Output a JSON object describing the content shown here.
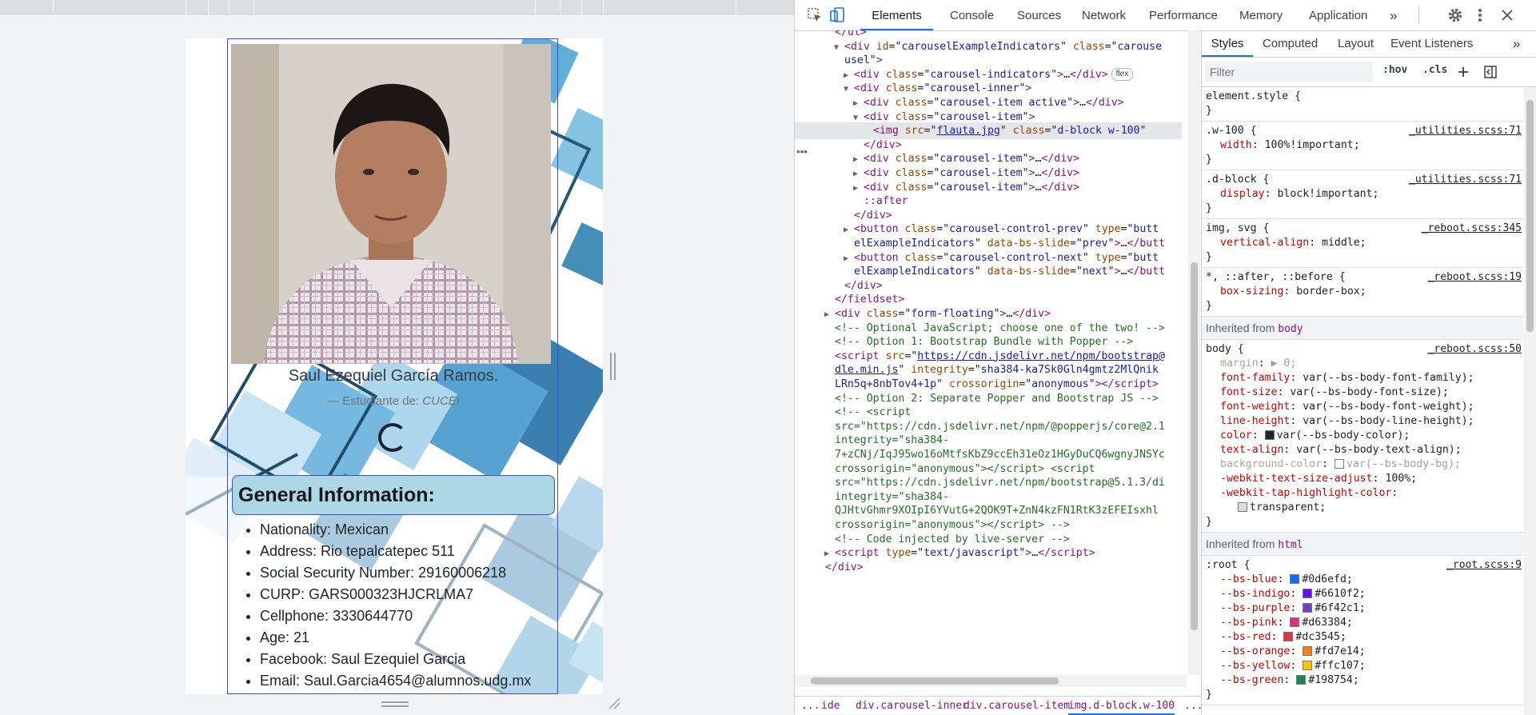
{
  "page": {
    "person_name": "Saul Ezequiel García Ramos.",
    "role_prefix": "— Estudiante de:",
    "role_org": "CUCEI",
    "info_title": "General Information:",
    "info_items": [
      "Nationality: Mexican",
      "Address: Rio tepalcatepec 511",
      "Social Security Number: 29160006218",
      "CURP: GARS000323HJCRLMA7",
      "Cellphone: 3330644770",
      "Age: 21",
      "Facebook: Saul Ezequiel Garcia",
      "Email: Saul.Garcia4654@alumnos.udg.mx"
    ]
  },
  "devtools": {
    "tabs": [
      "Elements",
      "Console",
      "Sources",
      "Network",
      "Performance",
      "Memory",
      "Application"
    ],
    "more_tabs": "»",
    "dom_lines": [
      {
        "indent": 0,
        "html": "<span class='tag'>&lt;/ul&gt;</span>"
      },
      {
        "indent": 1,
        "arrow": "▼",
        "html": "<span class='tag'>&lt;div</span> <span class='an'>id</span>=\"<span class='av'>carouselExampleIndicators</span>\" <span class='an'>class</span>=\"<span class='av'>carouse</span>"
      },
      {
        "indent": 1,
        "html": "<span class='av'>usel</span>\"<span class='tag'>&gt;</span>"
      },
      {
        "indent": 2,
        "arrow": "▶",
        "html": "<span class='tag'>&lt;div</span> <span class='an'>class</span>=\"<span class='av'>carousel-indicators</span>\"<span class='tag'>&gt;</span>…<span class='tag'>&lt;/div&gt;</span><span class='badge'>flex</span>"
      },
      {
        "indent": 2,
        "arrow": "▼",
        "html": "<span class='tag'>&lt;div</span> <span class='an'>class</span>=\"<span class='av'>carousel-inner</span>\"<span class='tag'>&gt;</span>"
      },
      {
        "indent": 3,
        "arrow": "▶",
        "html": "<span class='tag'>&lt;div</span> <span class='an'>class</span>=\"<span class='av'>carousel-item active</span>\"<span class='tag'>&gt;</span>…<span class='tag'>&lt;/div&gt;</span>"
      },
      {
        "indent": 3,
        "arrow": "▼",
        "html": "<span class='tag'>&lt;div</span> <span class='an'>class</span>=\"<span class='av'>carousel-item</span>\"<span class='tag'>&gt;</span>"
      },
      {
        "indent": 4,
        "sel": true,
        "html": "<span class='tag'>&lt;img</span> <span class='an'>src</span>=\"<span class='link'>flauta.jpg</span>\" <span class='an'>class</span>=\"<span class='av'>d-block w-100</span>\""
      },
      {
        "indent": 3,
        "html": "<span class='tag'>&lt;/div&gt;</span>"
      },
      {
        "indent": 3,
        "arrow": "▶",
        "html": "<span class='tag'>&lt;div</span> <span class='an'>class</span>=\"<span class='av'>carousel-item</span>\"<span class='tag'>&gt;</span>…<span class='tag'>&lt;/div&gt;</span>"
      },
      {
        "indent": 3,
        "arrow": "▶",
        "html": "<span class='tag'>&lt;div</span> <span class='an'>class</span>=\"<span class='av'>carousel-item</span>\"<span class='tag'>&gt;</span>…<span class='tag'>&lt;/div&gt;</span>"
      },
      {
        "indent": 3,
        "arrow": "▶",
        "html": "<span class='tag'>&lt;div</span> <span class='an'>class</span>=\"<span class='av'>carousel-item</span>\"<span class='tag'>&gt;</span>…<span class='tag'>&lt;/div&gt;</span>"
      },
      {
        "indent": 3,
        "html": "<span class='tag'>::after</span>"
      },
      {
        "indent": 2,
        "html": "<span class='tag'>&lt;/div&gt;</span>"
      },
      {
        "indent": 2,
        "arrow": "▶",
        "html": "<span class='tag'>&lt;button</span> <span class='an'>class</span>=\"<span class='av'>carousel-control-prev</span>\" <span class='an'>type</span>=\"<span class='av'>butt</span>"
      },
      {
        "indent": 2,
        "html": "<span class='av'>elExampleIndicators</span>\" <span class='an'>data-bs-slide</span>=\"<span class='av'>prev</span>\"<span class='tag'>&gt;</span>…<span class='tag'>&lt;/butt</span>"
      },
      {
        "indent": 2,
        "arrow": "▶",
        "html": "<span class='tag'>&lt;button</span> <span class='an'>class</span>=\"<span class='av'>carousel-control-next</span>\" <span class='an'>type</span>=\"<span class='av'>butt</span>"
      },
      {
        "indent": 2,
        "html": "<span class='av'>elExampleIndicators</span>\" <span class='an'>data-bs-slide</span>=\"<span class='av'>next</span>\"<span class='tag'>&gt;</span>…<span class='tag'>&lt;/butt</span>"
      },
      {
        "indent": 1,
        "html": "<span class='tag'>&lt;/div&gt;</span>"
      },
      {
        "indent": 0,
        "html": "<span class='tag'>&lt;/fieldset&gt;</span>"
      },
      {
        "indent": 0,
        "arrow": "▶",
        "html": "<span class='tag'>&lt;div</span> <span class='an'>class</span>=\"<span class='av'>form-floating</span>\"<span class='tag'>&gt;</span>…<span class='tag'>&lt;/div&gt;</span>"
      },
      {
        "indent": 0,
        "html": "<span class='cm'>&lt;!-- Optional JavaScript; choose one of the two! --&gt;</span>"
      },
      {
        "indent": 0,
        "html": "<span class='cm'>&lt;!-- Option 1: Bootstrap Bundle with Popper --&gt;</span>"
      },
      {
        "indent": 0,
        "html": "<span class='tag'>&lt;script</span> <span class='an'>src</span>=\"<span class='link'>https://cdn.jsdelivr.net/npm/bootstrap@</span>"
      },
      {
        "indent": 0,
        "html": "<span class='link'>dle.min.js</span>\" <span class='an'>integrity</span>=\"<span class='av'>sha384-ka7Sk0Gln4gmtz2MlQnik</span>"
      },
      {
        "indent": 0,
        "html": "<span class='av'>LRn5q+8nbTov4+1p</span>\" <span class='an'>crossorigin</span>=\"<span class='av'>anonymous</span>\"<span class='tag'>&gt;&lt;/script&gt;</span>"
      },
      {
        "indent": 0,
        "html": "<span class='cm'>&lt;!-- Option 2: Separate Popper and Bootstrap JS --&gt;</span>"
      },
      {
        "indent": 0,
        "html": "<span class='cm'>&lt;!--  &lt;script</span>"
      },
      {
        "indent": 0,
        "html": "<span class='cm'>src=\"https://cdn.jsdelivr.net/npm/@popperjs/core@2.1</span>"
      },
      {
        "indent": 0,
        "html": "<span class='cm'>integrity=\"sha384-</span>"
      },
      {
        "indent": 0,
        "html": "<span class='cm'>7+zCNj/IqJ95wo16oMtfsKbZ9ccEh31eOz1HGyDuCQ6wgnyJNSYc</span>"
      },
      {
        "indent": 0,
        "html": "<span class='cm'>crossorigin=\"anonymous\"&gt;&lt;/script&gt;  &lt;script</span>"
      },
      {
        "indent": 0,
        "html": "<span class='cm'>src=\"https://cdn.jsdelivr.net/npm/bootstrap@5.1.3/di</span>"
      },
      {
        "indent": 0,
        "html": "<span class='cm'>integrity=\"sha384-</span>"
      },
      {
        "indent": 0,
        "html": "<span class='cm'>QJHtvGhmr9XOIpI6YVutG+2QOK9T+ZnN4kzFN1RtK3zEFEIsxhl</span>"
      },
      {
        "indent": 0,
        "html": "<span class='cm'>crossorigin=\"anonymous\"&gt;&lt;/script&gt;  --&gt;</span>"
      },
      {
        "indent": 0,
        "html": "<span class='cm'>&lt;!-- Code injected by live-server --&gt;</span>"
      },
      {
        "indent": 0,
        "arrow": "▶",
        "html": "<span class='tag'>&lt;script</span> <span class='an'>type</span>=\"<span class='av'>text/javascript</span>\"<span class='tag'>&gt;</span>…<span class='tag'>&lt;/script&gt;</span>"
      },
      {
        "indent": -1,
        "html": "<span class='tag'>&lt;/div&gt;</span>"
      }
    ],
    "breadcrumb": [
      "...",
      "ide",
      "div.carousel-inner",
      "div.carousel-item",
      "img.d-block.w-100",
      "..."
    ],
    "styles_tabs": [
      "Styles",
      "Computed",
      "Layout",
      "Event Listeners"
    ],
    "filter_placeholder": "Filter",
    "filter_hov": ":hov",
    "filter_cls": ".cls",
    "rules": [
      {
        "selector": "element.style {",
        "source": "",
        "props": []
      },
      {
        "selector": ".w-100 {",
        "source": "_utilities.scss:71",
        "props": [
          [
            "width",
            "100%!important;"
          ]
        ]
      },
      {
        "selector": ".d-block {",
        "source": "_utilities.scss:71",
        "props": [
          [
            "display",
            "block!important;"
          ]
        ]
      },
      {
        "selector": "img, svg {",
        "source": "_reboot.scss:345",
        "props": [
          [
            "vertical-align",
            "middle;"
          ]
        ]
      },
      {
        "selector": "*, ::after, ::before {",
        "source": "_reboot.scss:19",
        "props": [
          [
            "box-sizing",
            "border-box;"
          ]
        ]
      }
    ],
    "inherited_body_label": "Inherited from",
    "inherited_body_tag": "body",
    "body_rule": {
      "selector": "body {",
      "source": "_reboot.scss:50",
      "props": [
        [
          "margin",
          "▶ 0;",
          true
        ],
        [
          "font-family",
          "var(--bs-body-font-family);"
        ],
        [
          "font-size",
          "var(--bs-body-font-size);"
        ],
        [
          "font-weight",
          "var(--bs-body-font-weight);"
        ],
        [
          "line-height",
          "var(--bs-body-line-height);"
        ],
        [
          "color",
          "var(--bs-body-color);"
        ],
        [
          "text-align",
          "var(--bs-body-text-align);"
        ],
        [
          "background-color",
          "var(--bs-body-bg);",
          true
        ],
        [
          "-webkit-text-size-adjust",
          "100%;"
        ],
        [
          "-webkit-tap-highlight-color",
          ""
        ],
        [
          "",
          "transparent;"
        ]
      ]
    },
    "inherited_html_tag": "html",
    "root_rule": {
      "selector": ":root {",
      "source": "_root.scss:9",
      "props": [
        [
          "--bs-blue",
          "#0d6efd;",
          "#0d6efd"
        ],
        [
          "--bs-indigo",
          "#6610f2;",
          "#6610f2"
        ],
        [
          "--bs-purple",
          "#6f42c1;",
          "#6f42c1"
        ],
        [
          "--bs-pink",
          "#d63384;",
          "#d63384"
        ],
        [
          "--bs-red",
          "#dc3545;",
          "#dc3545"
        ],
        [
          "--bs-orange",
          "#fd7e14;",
          "#fd7e14"
        ],
        [
          "--bs-yellow",
          "#ffc107;",
          "#ffc107"
        ],
        [
          "--bs-green",
          "#198754;",
          "#198754"
        ]
      ]
    }
  },
  "colors": {
    "accent": "#1a73e8",
    "info_header_bg": "#aed7e5",
    "deco_blue": "#3a87b5"
  }
}
